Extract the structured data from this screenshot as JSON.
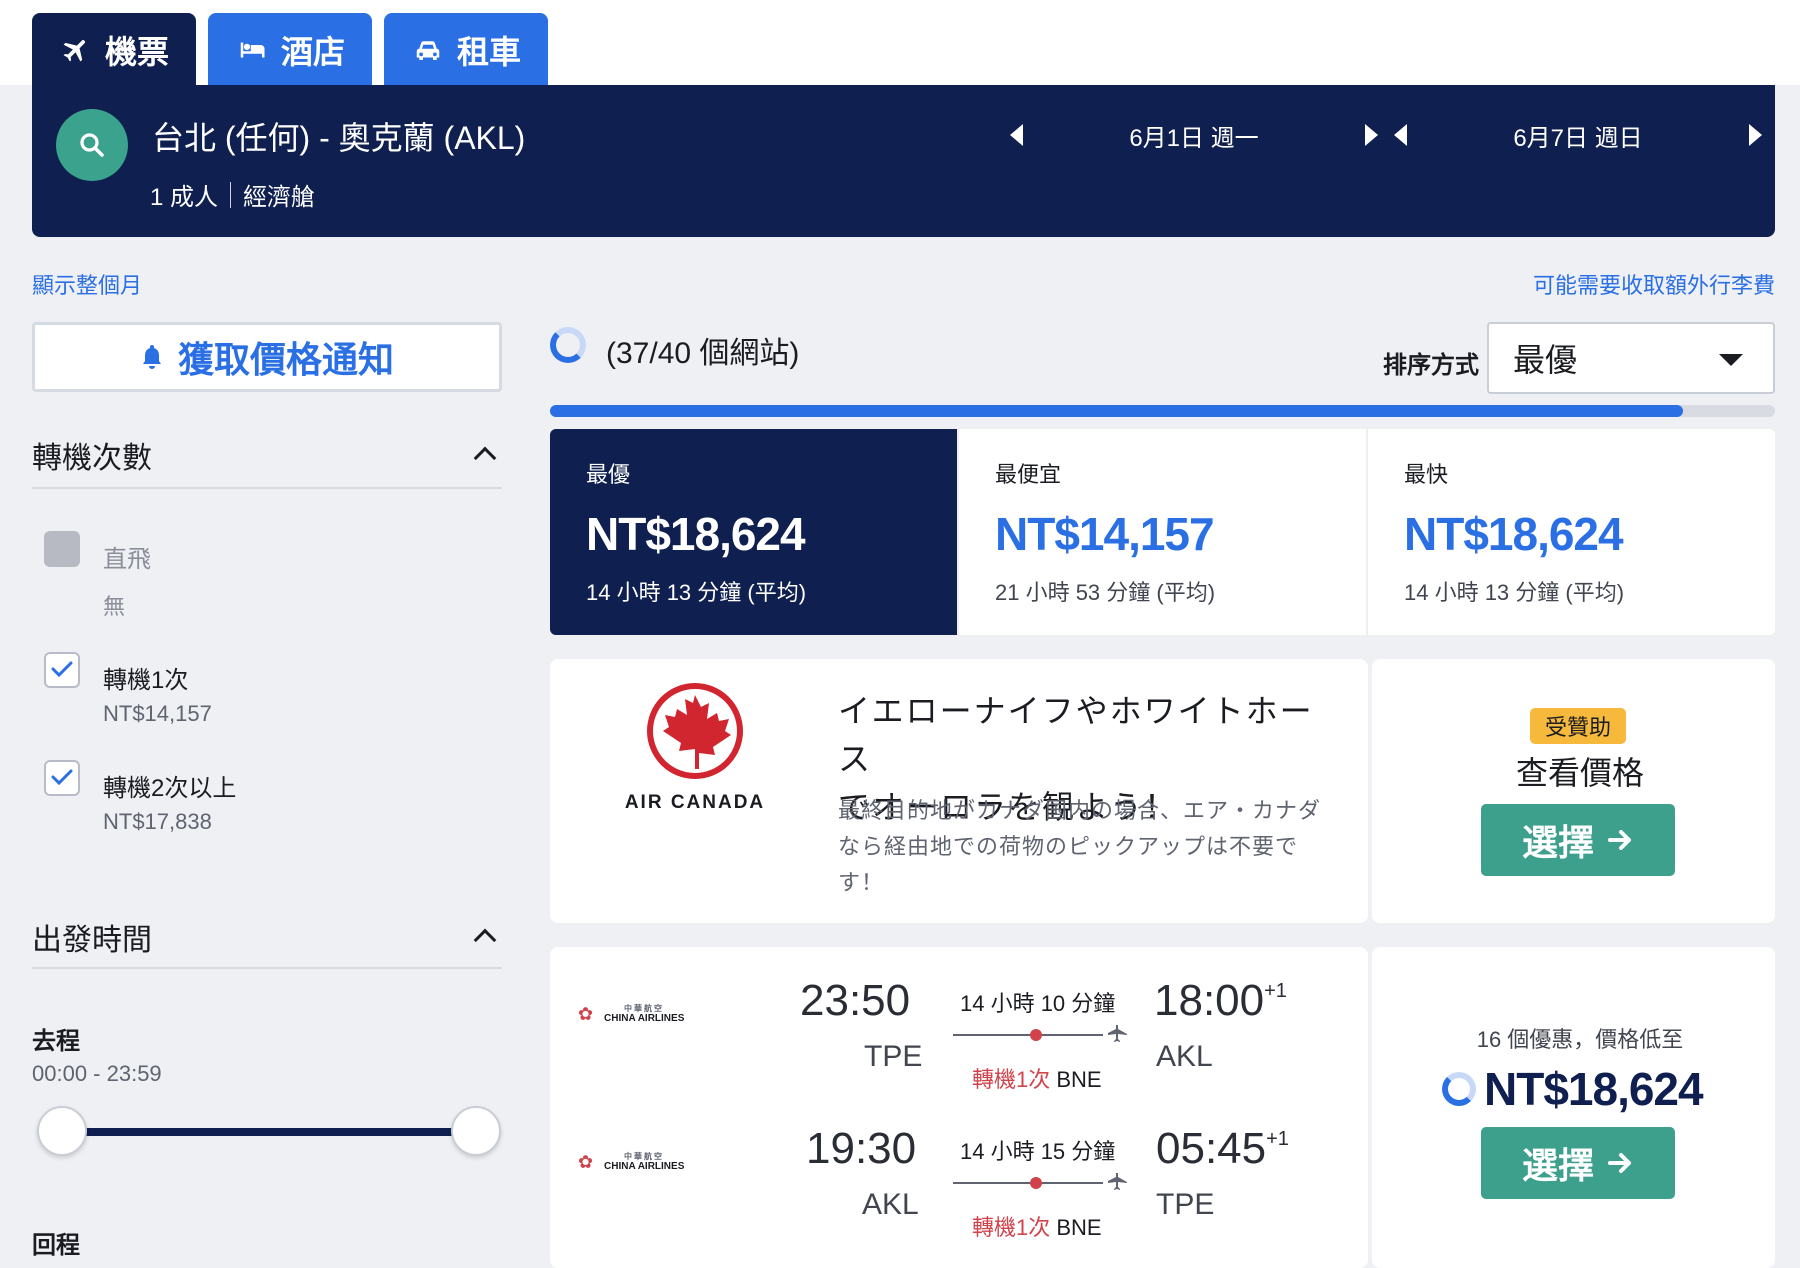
{
  "tabs": [
    {
      "label": "機票",
      "icon": "airplane-icon",
      "active": true
    },
    {
      "label": "酒店",
      "icon": "bed-icon",
      "active": false
    },
    {
      "label": "租車",
      "icon": "car-icon",
      "active": false
    }
  ],
  "search": {
    "route": "台北 (任何) - 奧克蘭 (AKL)",
    "passengers": "1 成人",
    "cabin": "經濟艙",
    "depart_date": "6月1日 週一",
    "return_date": "6月7日 週日",
    "icon": "search-icon"
  },
  "links": {
    "show_month": "顯示整個月",
    "baggage_fees": "可能需要收取額外行李費"
  },
  "price_alert": {
    "label": "獲取價格通知",
    "icon": "bell-icon"
  },
  "filters": {
    "stops": {
      "title": "轉機次數",
      "options": [
        {
          "label": "直飛",
          "sub": "無",
          "checked": false,
          "disabled": true
        },
        {
          "label": "轉機1次",
          "sub": "NT$14,157",
          "checked": true,
          "disabled": false
        },
        {
          "label": "轉機2次以上",
          "sub": "NT$17,838",
          "checked": true,
          "disabled": false
        }
      ]
    },
    "departure": {
      "title": "出發時間",
      "outbound_label": "去程",
      "outbound_range": "00:00 - 23:59",
      "return_label": "回程"
    }
  },
  "progress": {
    "text": "(37/40 個網站)",
    "fraction": 0.925
  },
  "sort": {
    "label": "排序方式",
    "value": "最優"
  },
  "summary": [
    {
      "label": "最優",
      "price": "NT$18,624",
      "duration": "14 小時 13 分鐘 (平均)",
      "active": true
    },
    {
      "label": "最便宜",
      "price": "NT$14,157",
      "duration": "21 小時 53 分鐘 (平均)",
      "active": false
    },
    {
      "label": "最快",
      "price": "NT$18,624",
      "duration": "14 小時 13 分鐘 (平均)",
      "active": false
    }
  ],
  "ad": {
    "brand": "AIR CANADA",
    "title": "イエローナイフやホワイトホースでオーローラを観よう！",
    "title_line1": "イエローナイフやホワイトホース",
    "title_line2": "でオーロラを観よう！",
    "body": "最終目的地がカナダ国内の場合、エア・カナダなら経由地での荷物のピックアップは不要です！",
    "sponsored": "受贊助",
    "view_price": "查看價格",
    "select": "選擇"
  },
  "result": {
    "deals": "16 個優惠，價格低至",
    "price": "NT$18,624",
    "select": "選擇",
    "legs": [
      {
        "airline": "CHINA AIRLINES",
        "airline_cn": "中華航空",
        "depart_time": "23:50",
        "depart_airport": "TPE",
        "duration": "14 小時 10 分鐘",
        "stops": "轉機1次",
        "via": "BNE",
        "arrive_time": "18:00",
        "day_offset": "+1",
        "arrive_airport": "AKL"
      },
      {
        "airline": "CHINA AIRLINES",
        "airline_cn": "中華航空",
        "depart_time": "19:30",
        "depart_airport": "AKL",
        "duration": "14 小時 15 分鐘",
        "stops": "轉機1次",
        "via": "BNE",
        "arrive_time": "05:45",
        "day_offset": "+1",
        "arrive_airport": "TPE"
      }
    ]
  },
  "colors": {
    "navy": "#0f1f4f",
    "blue": "#2b6fe4",
    "green": "#3ca08d",
    "red": "#d1434b",
    "badge": "#f6b93b"
  }
}
